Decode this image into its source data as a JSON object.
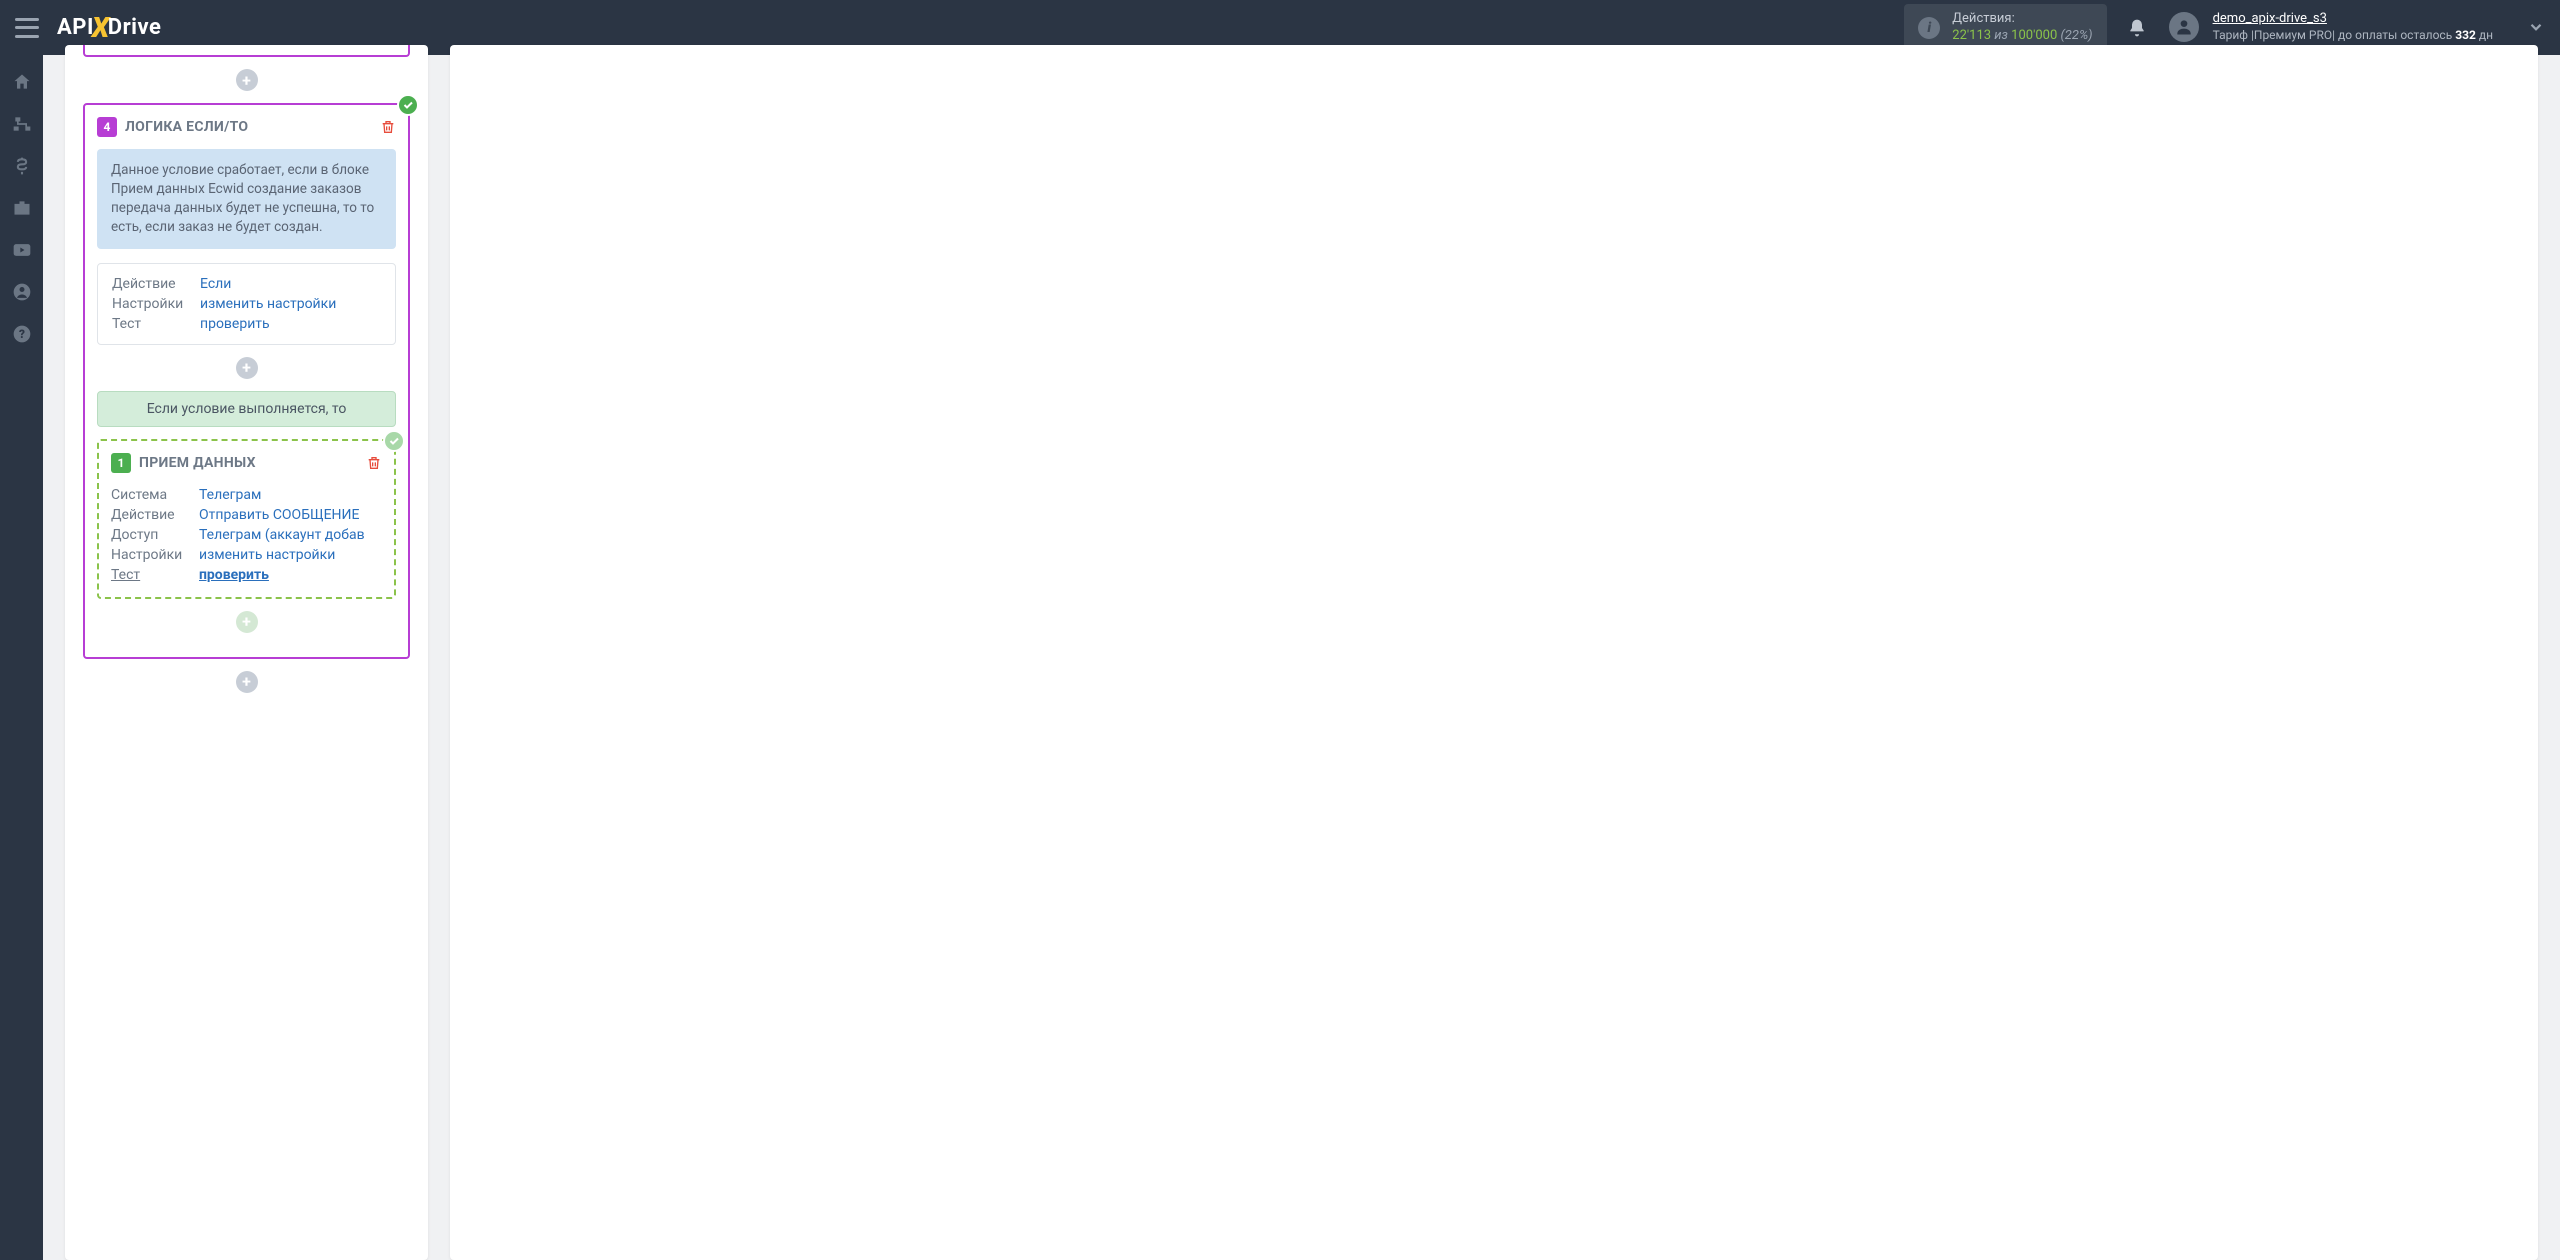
{
  "header": {
    "actions_label": "Действия:",
    "actions_current": "22'113",
    "actions_sep": " из ",
    "actions_max": "100'000",
    "actions_pct": " (22%)",
    "user_name": "demo_apix-drive_s3",
    "tariff_prefix": "Тариф |Премиум PRO| до оплаты осталось ",
    "tariff_days": "332",
    "tariff_suffix": " дн"
  },
  "logic_block": {
    "step": "4",
    "title": "ЛОГИКА ЕСЛИ/ТО",
    "description": "Данное условие сработает, если в блоке Прием данных Ecwid создание заказов передача данных будет не успешна, то то есть, если заказ не будет создан.",
    "rows": {
      "action_key": "Действие",
      "action_val": "Если",
      "settings_key": "Настройки",
      "settings_val": "изменить настройки",
      "test_key": "Тест",
      "test_val": "проверить"
    },
    "condition_text": "Если условие выполняется, то"
  },
  "data_block": {
    "step": "1",
    "title": "ПРИЕМ ДАННЫХ",
    "rows": {
      "system_key": "Система",
      "system_val": "Телеграм",
      "action_key": "Действие",
      "action_val": "Отправить СООБЩЕНИЕ",
      "access_key": "Доступ",
      "access_val": "Телеграм (аккаунт добав",
      "settings_key": "Настройки",
      "settings_val": "изменить настройки",
      "test_key": "Тест",
      "test_val": "проверить"
    }
  }
}
